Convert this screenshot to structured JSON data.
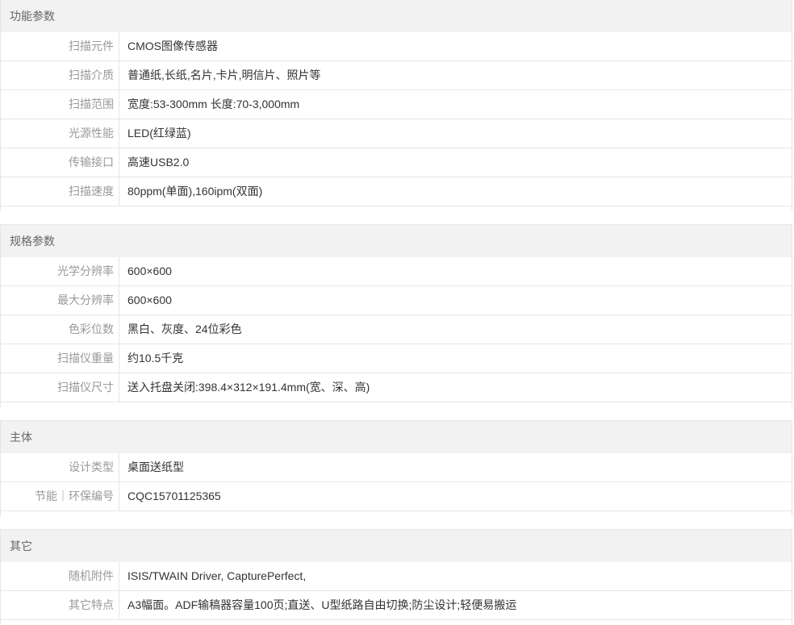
{
  "sections": [
    {
      "title": "功能参数",
      "rows": [
        {
          "key": "扫描元件",
          "value": "CMOS图像传感器"
        },
        {
          "key": "扫描介质",
          "value": "普通纸,长纸,名片,卡片,明信片、照片等"
        },
        {
          "key": "扫描范围",
          "value": "宽度:53-300mm 长度:70-3,000mm"
        },
        {
          "key": "光源性能",
          "value": "LED(红绿蓝)"
        },
        {
          "key": "传输接口",
          "value": "高速USB2.0"
        },
        {
          "key": "扫描速度",
          "value": "80ppm(单面),160ipm(双面)"
        }
      ]
    },
    {
      "title": "规格参数",
      "rows": [
        {
          "key": "光学分辨率",
          "value": "600×600"
        },
        {
          "key": "最大分辨率",
          "value": "600×600"
        },
        {
          "key": "色彩位数",
          "value": "黑白、灰度、24位彩色"
        },
        {
          "key": "扫描仪重量",
          "value": "约10.5千克"
        },
        {
          "key": "扫描仪尺寸",
          "value": "送入托盘关闭:398.4×312×191.4mm(宽、深、高)"
        }
      ]
    },
    {
      "title": "主体",
      "rows": [
        {
          "key": "设计类型",
          "value": "桌面送纸型"
        },
        {
          "key": "节能｜环保编号",
          "value": "CQC15701125365"
        }
      ]
    },
    {
      "title": "其它",
      "rows": [
        {
          "key": "随机附件",
          "value": "ISIS/TWAIN Driver, CapturePerfect,"
        },
        {
          "key": "其它特点",
          "value": "A3幅面。ADF输稿器容量100页;直送、U型纸路自由切换;防尘设计;轻便易搬运"
        }
      ]
    }
  ]
}
